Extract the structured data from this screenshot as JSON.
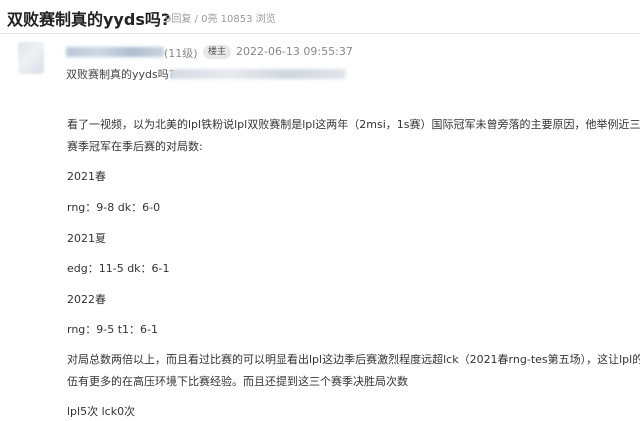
{
  "thread": {
    "title": "双败赛制真的yyds吗?",
    "stats": "9回复 / 0亮 10853 浏览"
  },
  "post": {
    "user_level": "(11级)",
    "op_badge": "楼主",
    "time": "2022-06-13 09:55:37",
    "quoted_title": "双败赛制真的yyds吗?",
    "lines": [
      "看了一视频，以为北美的lpl铁粉说lpl双败赛制是lpl这两年（2msi，1s赛）国际冠军未曾旁落的主要原因，他举例近三个",
      "赛季冠军在季后赛的对局数:",
      "2021春",
      "rng：9-8    dk：6-0",
      "2021夏",
      "edg：11-5    dk：6-1",
      "2022春",
      "rng：9-5    t1：6-1",
      "对局总数两倍以上，而且看过比赛的可以明显看出lpl这边季后赛激烈程度远超lck（2021春rng-tes第五场），这让lpl的队",
      "伍有更多的在高压环境下比赛经验。而且还提到这三个赛季决胜局次数",
      "lpl5次    lck0次"
    ]
  }
}
